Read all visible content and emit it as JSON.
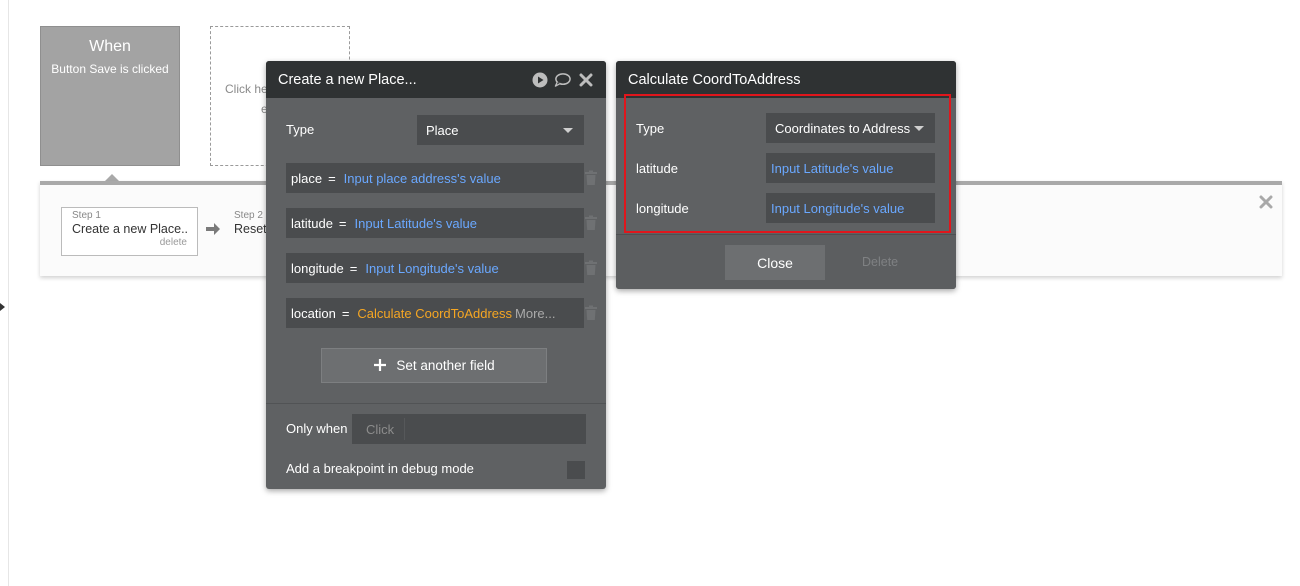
{
  "event": {
    "title": "When",
    "subtitle": "Button Save is clicked"
  },
  "placeholder_text": [
    "Click he",
    "e"
  ],
  "steps": [
    {
      "number": "Step 1",
      "name": "Create a new Place...",
      "delete_label": "delete"
    },
    {
      "number": "Step 2",
      "name": "Reset"
    }
  ],
  "create_panel": {
    "title": "Create a new Place...",
    "type_label": "Type",
    "type_value": "Place",
    "fields": [
      {
        "name": "place",
        "eq": "=",
        "value": "Input place address's value",
        "more": ""
      },
      {
        "name": "latitude",
        "eq": "=",
        "value": "Input Latitude's value",
        "more": ""
      },
      {
        "name": "longitude",
        "eq": "=",
        "value": "Input Longitude's value",
        "more": ""
      },
      {
        "name": "location",
        "eq": "=",
        "value": "Calculate CoordToAddress",
        "more": "More..."
      }
    ],
    "set_field_label": "Set another field",
    "only_when_label": "Only when",
    "only_when_placeholder": "Click",
    "breakpoint_label": "Add a breakpoint in debug mode"
  },
  "calc_panel": {
    "title": "Calculate CoordToAddress",
    "type_label": "Type",
    "type_value": "Coordinates to Address",
    "latitude_label": "latitude",
    "latitude_value": "Input Latitude's value",
    "longitude_label": "longitude",
    "longitude_value": "Input Longitude's value",
    "close_label": "Close",
    "delete_label": "Delete"
  },
  "colors": {
    "panel_bg": "#5f6163",
    "panel_header": "#2f3233",
    "link_blue": "#6aa8ff",
    "link_orange": "#f5a623",
    "highlight_red": "#e0161c"
  },
  "icons": [
    "play-icon",
    "comment-icon",
    "close-icon",
    "trash-icon",
    "plus-icon",
    "arrow-right-icon"
  ]
}
